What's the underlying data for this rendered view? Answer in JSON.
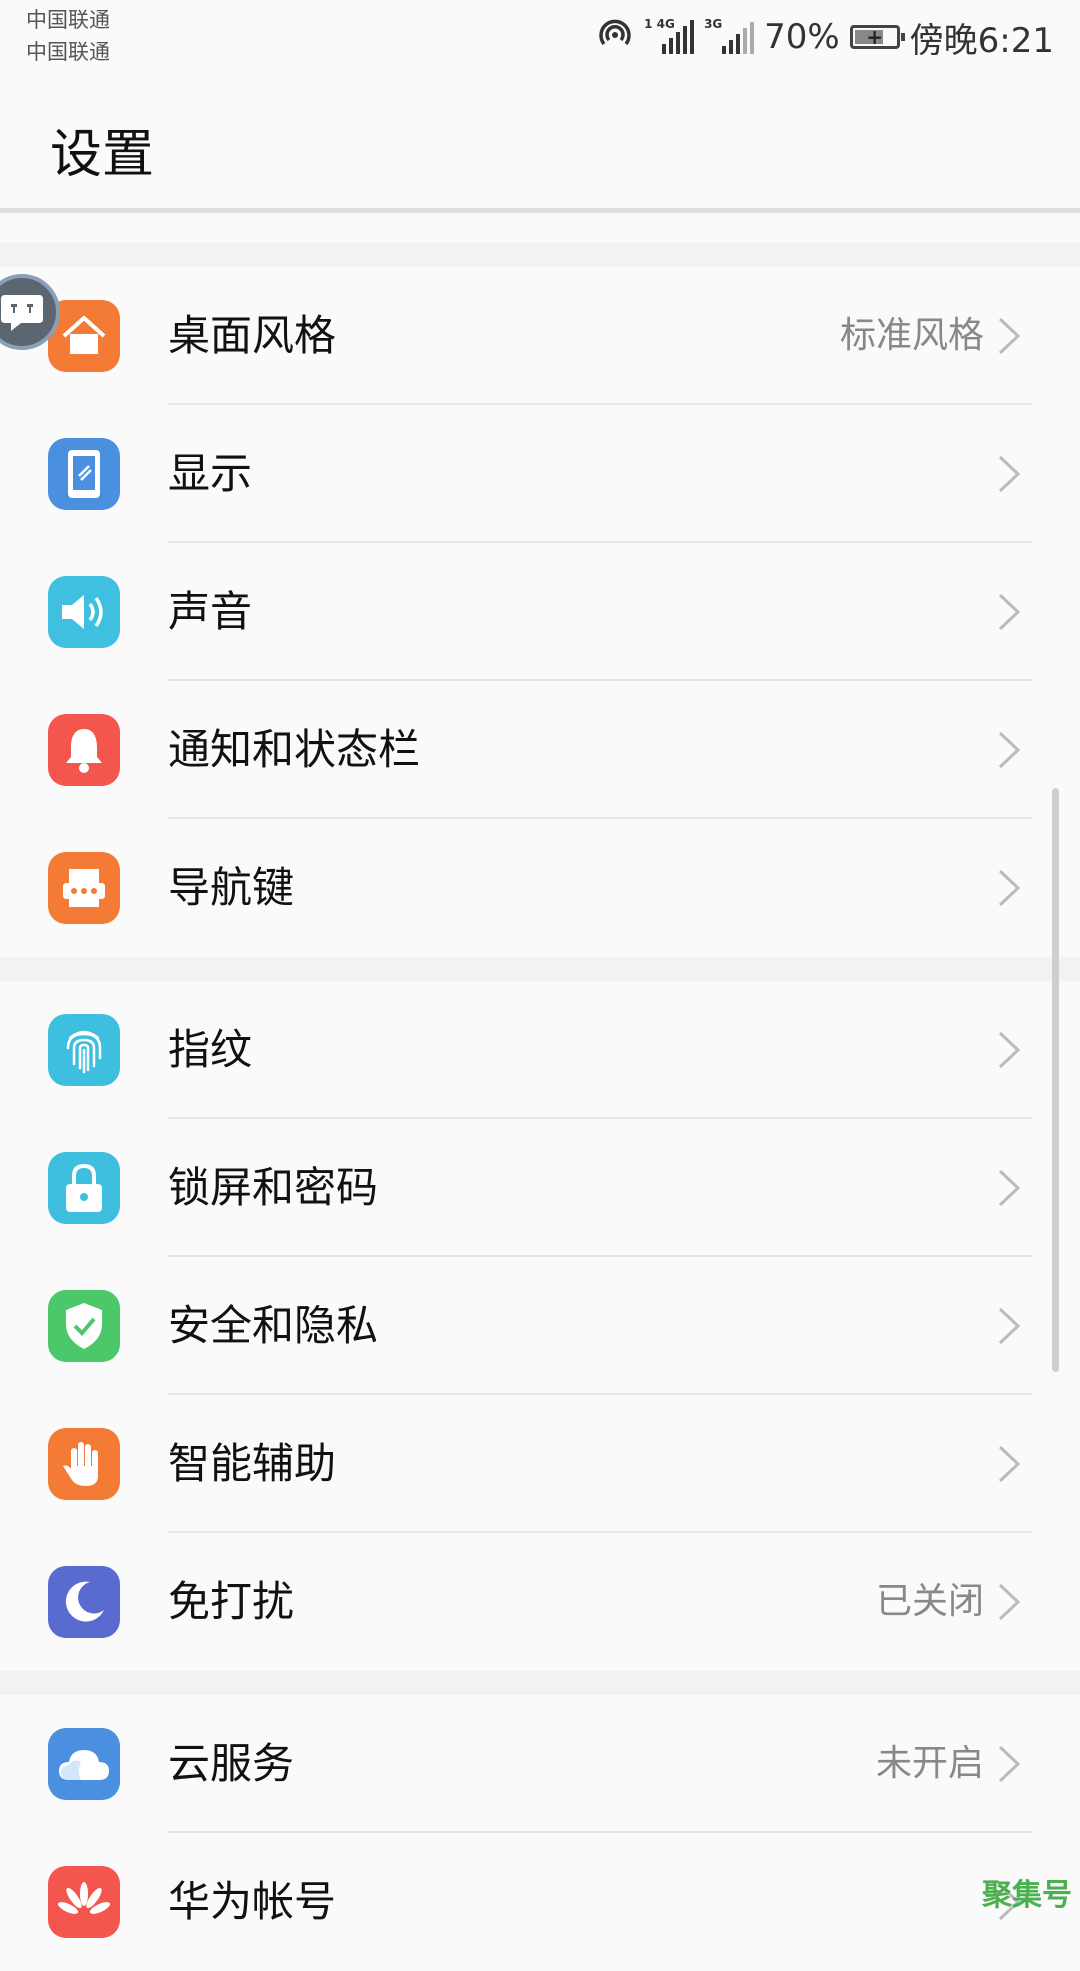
{
  "status_bar": {
    "carrier_1": "中国联通",
    "carrier_2": "中国联通",
    "signal_1": "1 4G",
    "signal_2": "3G",
    "battery_percent": "70%",
    "battery_level": 0.7,
    "time": "傍晚6:21"
  },
  "header": {
    "title": "设置"
  },
  "rows": [
    {
      "label": "桌面风格",
      "value": "标准风格",
      "icon": "home-icon",
      "color": "#f47b35"
    },
    {
      "label": "显示",
      "value": "",
      "icon": "display-icon",
      "color": "#4a8fe0"
    },
    {
      "label": "声音",
      "value": "",
      "icon": "speaker-icon",
      "color": "#3fc0e0"
    },
    {
      "label": "通知和状态栏",
      "value": "",
      "icon": "bell-icon",
      "color": "#f2564d"
    },
    {
      "label": "导航键",
      "value": "",
      "icon": "navigation-key-icon",
      "color": "#f47b35"
    },
    {
      "label": "指纹",
      "value": "",
      "icon": "fingerprint-icon",
      "color": "#3fbfe0"
    },
    {
      "label": "锁屏和密码",
      "value": "",
      "icon": "lock-icon",
      "color": "#3fbfe0"
    },
    {
      "label": "安全和隐私",
      "value": "",
      "icon": "shield-check-icon",
      "color": "#4cc86a"
    },
    {
      "label": "智能辅助",
      "value": "",
      "icon": "hand-icon",
      "color": "#f47b35"
    },
    {
      "label": "免打扰",
      "value": "已关闭",
      "icon": "moon-icon",
      "color": "#5a6bd0"
    },
    {
      "label": "云服务",
      "value": "未开启",
      "icon": "cloud-icon",
      "color": "#4a8fe0"
    },
    {
      "label": "华为帐号",
      "value": "",
      "icon": "huawei-logo-icon",
      "color": "#f2564d"
    }
  ],
  "watermark": "聚集号"
}
